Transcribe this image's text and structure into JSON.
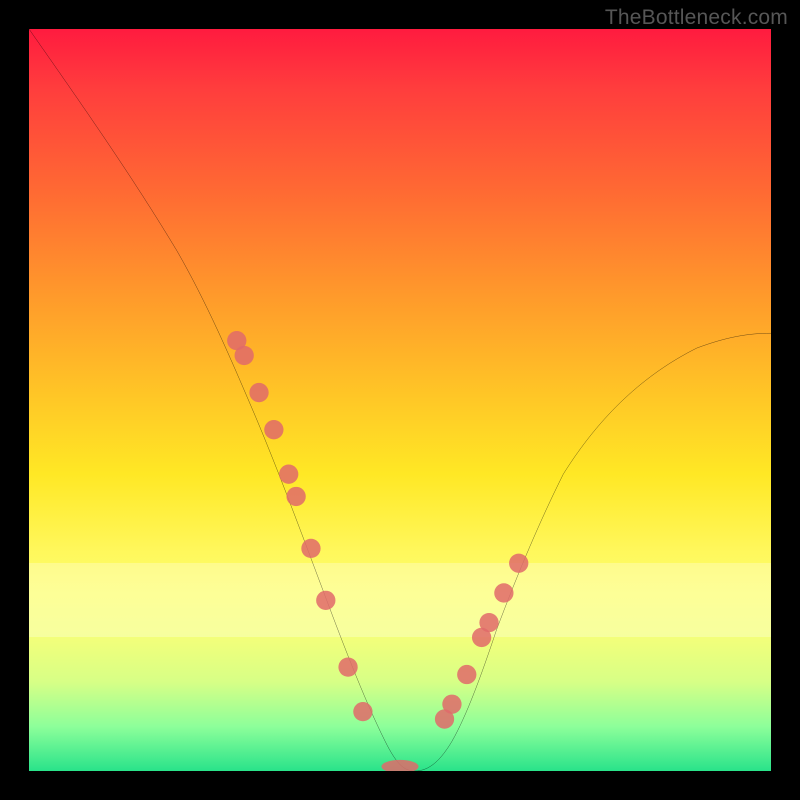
{
  "branding": "TheBottleneck.com",
  "chart_data": {
    "type": "line",
    "title": "",
    "xlabel": "",
    "ylabel": "",
    "xlim": [
      0,
      100
    ],
    "ylim": [
      0,
      100
    ],
    "x": [
      0,
      5,
      10,
      15,
      20,
      25,
      28,
      30,
      32,
      34,
      36,
      38,
      40,
      42,
      44,
      46,
      48,
      50,
      52,
      54,
      56,
      58,
      60,
      64,
      68,
      72,
      76,
      80,
      84,
      88,
      92,
      96,
      100
    ],
    "y": [
      100,
      93,
      86,
      79,
      72,
      64,
      58,
      53,
      48,
      42,
      36,
      30,
      23,
      16,
      9,
      4,
      1,
      0,
      0,
      1,
      4,
      9,
      15,
      24,
      32,
      38,
      43,
      48,
      51,
      54,
      56,
      58,
      59
    ],
    "marker_points": {
      "x": [
        28,
        29,
        31,
        33,
        35,
        36,
        38,
        40,
        43,
        45,
        50,
        56,
        57,
        59,
        61,
        62,
        64,
        66
      ],
      "y": [
        58,
        56,
        51,
        46,
        40,
        37,
        30,
        23,
        14,
        8,
        0,
        7,
        9,
        13,
        18,
        20,
        24,
        28
      ]
    },
    "gradient_stops": [
      {
        "pos": 0.0,
        "color": "#ff1b3f"
      },
      {
        "pos": 0.5,
        "color": "#ffc826"
      },
      {
        "pos": 0.8,
        "color": "#fdff6f"
      },
      {
        "pos": 1.0,
        "color": "#29e38a"
      }
    ],
    "pale_band_y": [
      72,
      82
    ]
  }
}
